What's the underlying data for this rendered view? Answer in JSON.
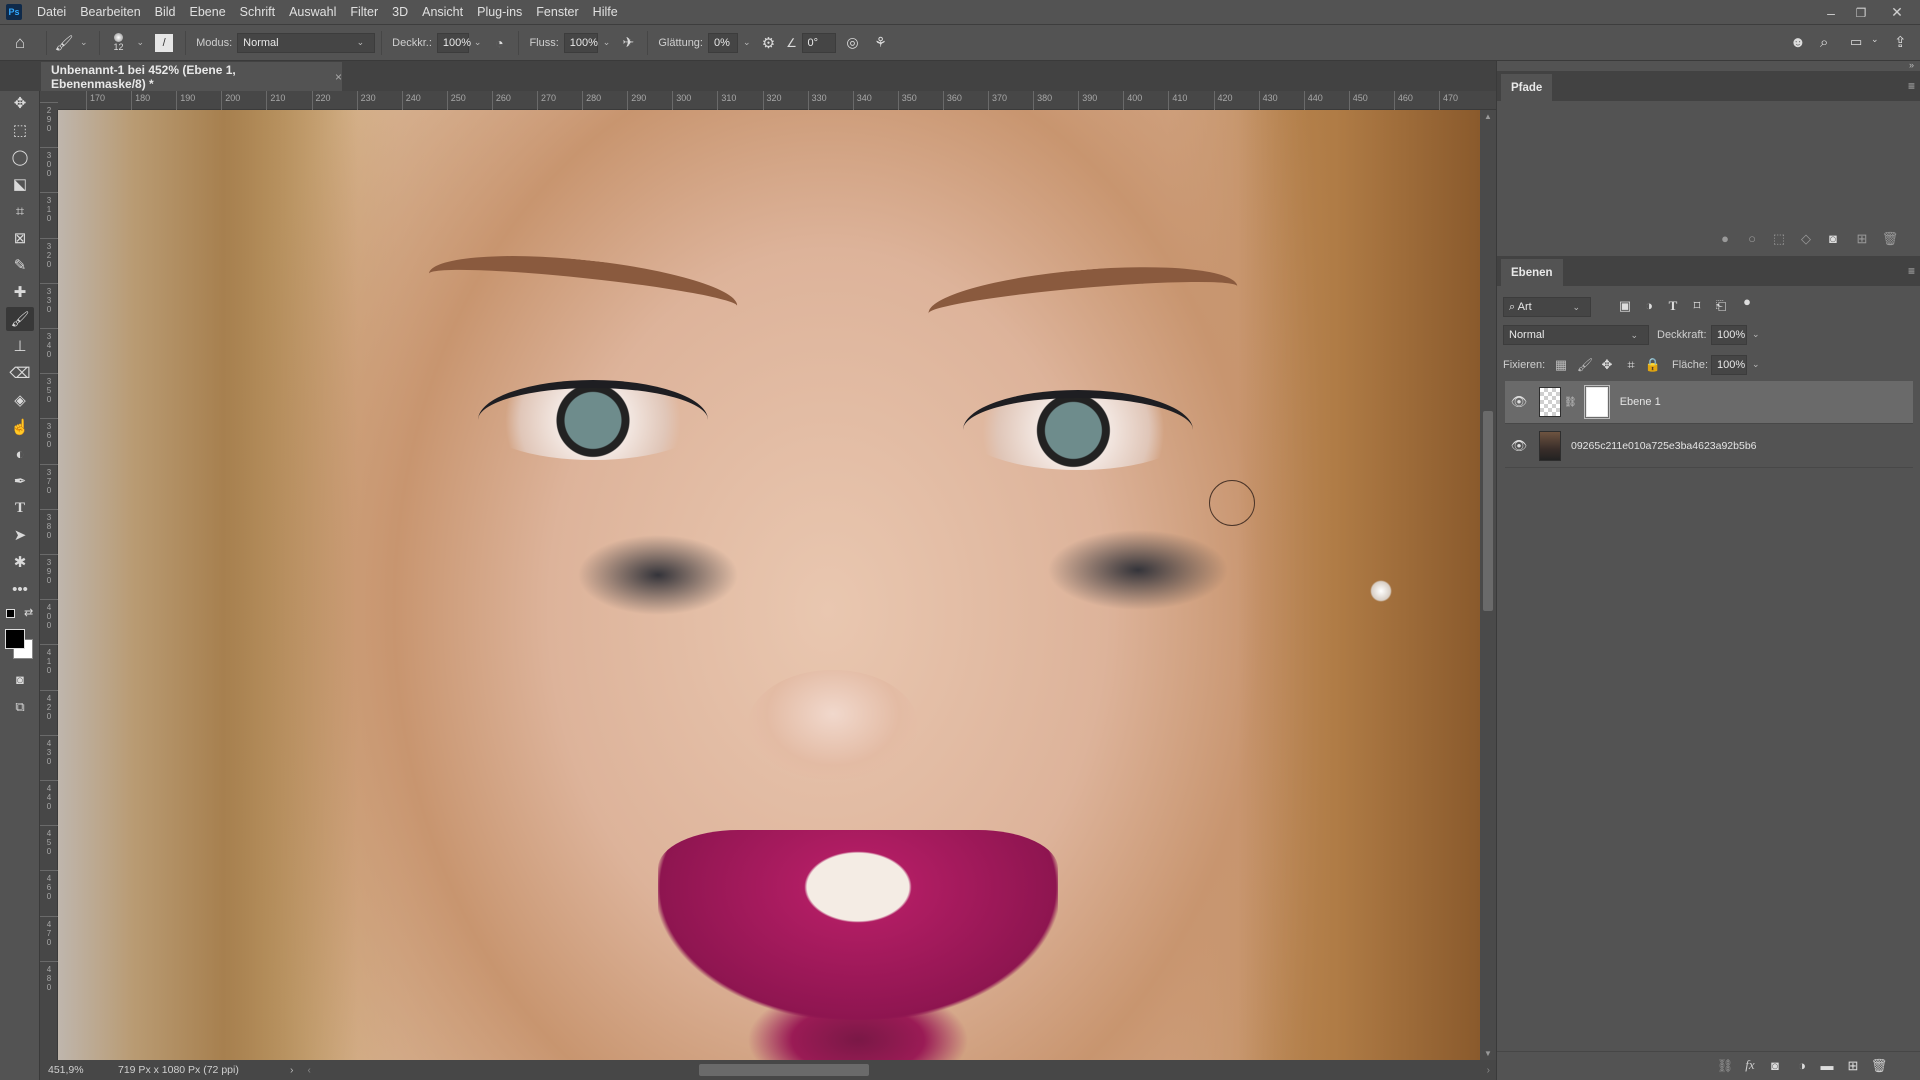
{
  "app": {
    "logo": "Ps"
  },
  "menu": [
    "Datei",
    "Bearbeiten",
    "Bild",
    "Ebene",
    "Schrift",
    "Auswahl",
    "Filter",
    "3D",
    "Ansicht",
    "Plug-ins",
    "Fenster",
    "Hilfe"
  ],
  "window_controls": {
    "minimize": "–",
    "restore": "❐",
    "close": "✕"
  },
  "options": {
    "brush_size": "12",
    "modus_label": "Modus:",
    "modus_value": "Normal",
    "opacity_label": "Deckkr.:",
    "opacity_value": "100%",
    "flow_label": "Fluss:",
    "flow_value": "100%",
    "smoothing_label": "Glättung:",
    "smoothing_value": "0%",
    "angle_value": "0°"
  },
  "document": {
    "tab_title": "Unbenannt-1 bei 452% (Ebene 1, Ebenenmaske/8) *",
    "tab_close": "×",
    "zoom": "451,9%",
    "dimensions": "719 Px x 1080 Px (72 ppi)",
    "status_arrow": "›",
    "brush_cursor_icon": "brush-cursor"
  },
  "rulers": {
    "horizontal": [
      "170",
      "180",
      "190",
      "200",
      "210",
      "220",
      "230",
      "240",
      "250",
      "260",
      "270",
      "280",
      "290",
      "300",
      "310",
      "320",
      "330",
      "340",
      "350",
      "360",
      "370",
      "380",
      "390",
      "400",
      "410",
      "420",
      "430",
      "440",
      "450",
      "460",
      "470"
    ],
    "vertical": [
      "290",
      "300",
      "310",
      "320",
      "330",
      "340",
      "350",
      "360",
      "370",
      "380",
      "390",
      "400",
      "410",
      "420",
      "430",
      "440",
      "450",
      "460",
      "470",
      "480"
    ]
  },
  "panels": {
    "paths": {
      "tab": "Pfade"
    },
    "layers": {
      "tab": "Ebenen",
      "filter_kind": "Art",
      "blend_mode": "Normal",
      "opacity_label": "Deckkraft:",
      "opacity_value": "100%",
      "lock_label": "Fixieren:",
      "fill_label": "Fläche:",
      "fill_value": "100%",
      "items": [
        {
          "name": "Ebene 1",
          "visible": true,
          "selected": true,
          "has_mask": true
        },
        {
          "name": "09265c211e010a725e3ba4623a92b5b6",
          "visible": true,
          "selected": false,
          "has_mask": false
        }
      ]
    }
  },
  "colors": {
    "foreground": "#000000",
    "background": "#ffffff",
    "ui_bg": "#535353",
    "ui_dark": "#424242",
    "selected_layer": "#6a6a6a"
  }
}
